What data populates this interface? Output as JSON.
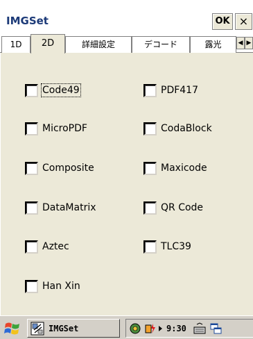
{
  "window": {
    "title": "IMGSet",
    "ok_label": "OK",
    "close_label": "×"
  },
  "tabs": [
    {
      "label": "1D"
    },
    {
      "label": "2D"
    },
    {
      "label": "詳細設定"
    },
    {
      "label": "デコード"
    },
    {
      "label": "露光"
    }
  ],
  "tab_scroll": {
    "left": "◀",
    "right": "▶"
  },
  "options": [
    {
      "label": "Code49",
      "checked": false
    },
    {
      "label": "PDF417",
      "checked": false
    },
    {
      "label": "MicroPDF",
      "checked": false
    },
    {
      "label": "CodaBlock",
      "checked": false
    },
    {
      "label": "Composite",
      "checked": false
    },
    {
      "label": "Maxicode",
      "checked": false
    },
    {
      "label": "DataMatrix",
      "checked": false
    },
    {
      "label": "QR Code",
      "checked": false
    },
    {
      "label": "Aztec",
      "checked": false
    },
    {
      "label": "TLC39",
      "checked": false
    },
    {
      "label": "Han Xin",
      "checked": false
    }
  ],
  "taskbar": {
    "task_label": "IMGSet",
    "clock": "9:30"
  },
  "colors": {
    "panel": "#ece9d8",
    "title_text": "#1c3a78"
  }
}
